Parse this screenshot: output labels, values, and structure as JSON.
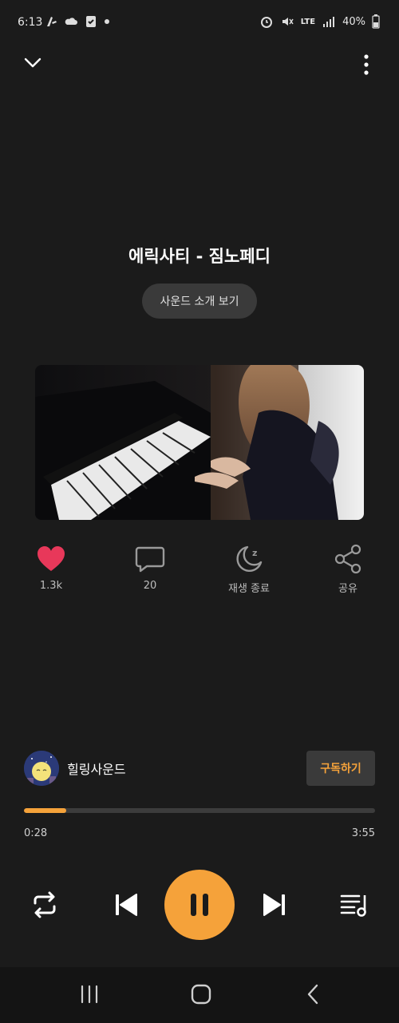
{
  "status_bar": {
    "time": "6:13",
    "network": "LTE",
    "battery": "40%"
  },
  "track": {
    "title": "에릭사티 - 짐노페디",
    "intro_label": "사운드 소개 보기"
  },
  "actions": [
    {
      "icon": "heart-icon",
      "label": "1.3k"
    },
    {
      "icon": "comment-icon",
      "label": "20"
    },
    {
      "icon": "sleep-timer-icon",
      "label": "재생 종료"
    },
    {
      "icon": "share-icon",
      "label": "공유"
    }
  ],
  "channel": {
    "name": "힐링사운드",
    "subscribe_label": "구독하기"
  },
  "player": {
    "current_time": "0:28",
    "total_time": "3:55",
    "progress": 0.12
  },
  "colors": {
    "accent": "#f5a23a",
    "heart": "#e8385a",
    "background": "#1b1b1b"
  }
}
